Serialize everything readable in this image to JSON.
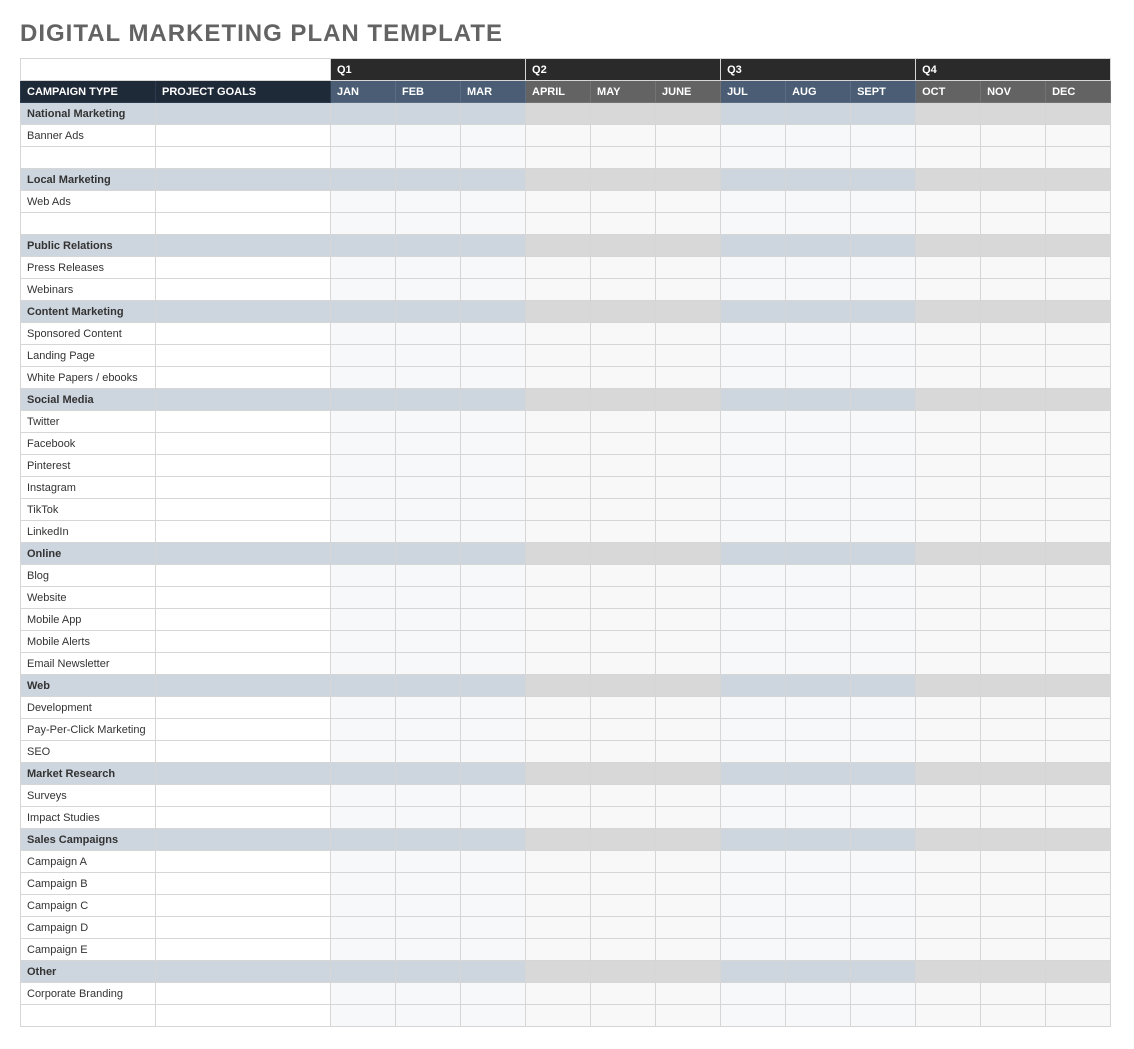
{
  "title": "DIGITAL MARKETING PLAN TEMPLATE",
  "headers": {
    "campaign_type": "CAMPAIGN TYPE",
    "project_goals": "PROJECT GOALS",
    "quarters": [
      "Q1",
      "Q2",
      "Q3",
      "Q4"
    ],
    "months": {
      "q1": [
        "JAN",
        "FEB",
        "MAR"
      ],
      "q2": [
        "APRIL",
        "MAY",
        "JUNE"
      ],
      "q3": [
        "JUL",
        "AUG",
        "SEPT"
      ],
      "q4": [
        "OCT",
        "NOV",
        "DEC"
      ]
    }
  },
  "sections": [
    {
      "name": "National Marketing",
      "rows": [
        "Banner Ads",
        ""
      ]
    },
    {
      "name": "Local Marketing",
      "rows": [
        "Web Ads",
        ""
      ]
    },
    {
      "name": "Public Relations",
      "rows": [
        "Press Releases",
        "Webinars"
      ]
    },
    {
      "name": "Content Marketing",
      "rows": [
        "Sponsored Content",
        "Landing Page",
        "White Papers / ebooks"
      ]
    },
    {
      "name": "Social Media",
      "rows": [
        "Twitter",
        "Facebook",
        "Pinterest",
        "Instagram",
        "TikTok",
        "LinkedIn"
      ]
    },
    {
      "name": "Online",
      "rows": [
        "Blog",
        "Website",
        "Mobile App",
        "Mobile Alerts",
        "Email Newsletter"
      ]
    },
    {
      "name": "Web",
      "rows": [
        "Development",
        "Pay-Per-Click Marketing",
        "SEO"
      ]
    },
    {
      "name": "Market Research",
      "rows": [
        "Surveys",
        "Impact Studies"
      ]
    },
    {
      "name": "Sales Campaigns",
      "rows": [
        "Campaign A",
        "Campaign B",
        "Campaign C",
        "Campaign D",
        "Campaign E"
      ]
    },
    {
      "name": "Other",
      "rows": [
        "Corporate Branding",
        ""
      ]
    }
  ]
}
